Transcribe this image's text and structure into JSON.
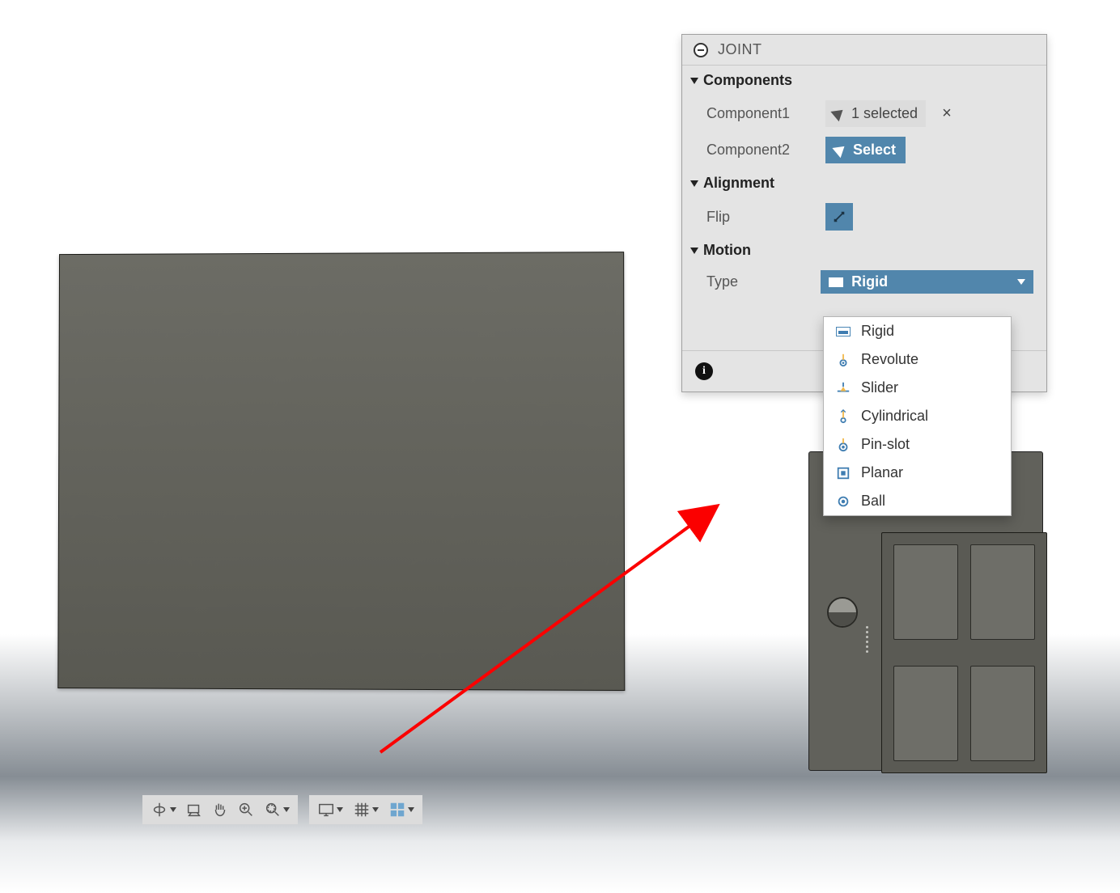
{
  "panel": {
    "title": "JOINT",
    "sections": {
      "components": {
        "label": "Components",
        "component1_label": "Component1",
        "component1_value": "1 selected",
        "component2_label": "Component2",
        "component2_action": "Select"
      },
      "alignment": {
        "label": "Alignment",
        "flip_label": "Flip"
      },
      "motion": {
        "label": "Motion",
        "type_label": "Type",
        "type_value": "Rigid",
        "options": [
          "Rigid",
          "Revolute",
          "Slider",
          "Cylindrical",
          "Pin-slot",
          "Planar",
          "Ball"
        ]
      }
    }
  },
  "toolbar": {
    "group1": [
      "orbit",
      "look-at",
      "pan",
      "zoom",
      "fit"
    ],
    "group2": [
      "display",
      "grid",
      "viewports"
    ]
  },
  "colors": {
    "accent": "#5186ac",
    "panel_bg": "#e4e4e4",
    "arrow": "#fb0000"
  }
}
